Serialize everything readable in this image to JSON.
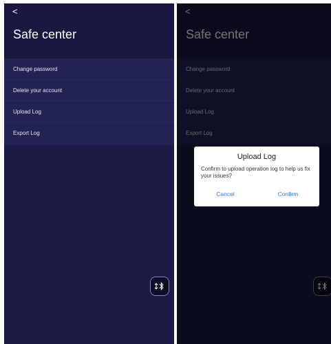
{
  "header": {
    "back_glyph": "<",
    "title": "Safe center"
  },
  "menu": {
    "items": [
      {
        "label": "Change password"
      },
      {
        "label": "Delete your account"
      },
      {
        "label": "Upload Log"
      },
      {
        "label": "Export Log"
      }
    ]
  },
  "fab": {
    "icon": "bluetooth-sort-icon"
  },
  "dialog": {
    "title": "Upload Log",
    "message": "Confirm to upload operation log to help us fix your issues?",
    "cancel_label": "Cancel",
    "confirm_label": "Confirm"
  },
  "colors": {
    "background": "#1b1b46",
    "header": "#191940",
    "menu": "#222253",
    "accent": "#2f7bd6"
  }
}
